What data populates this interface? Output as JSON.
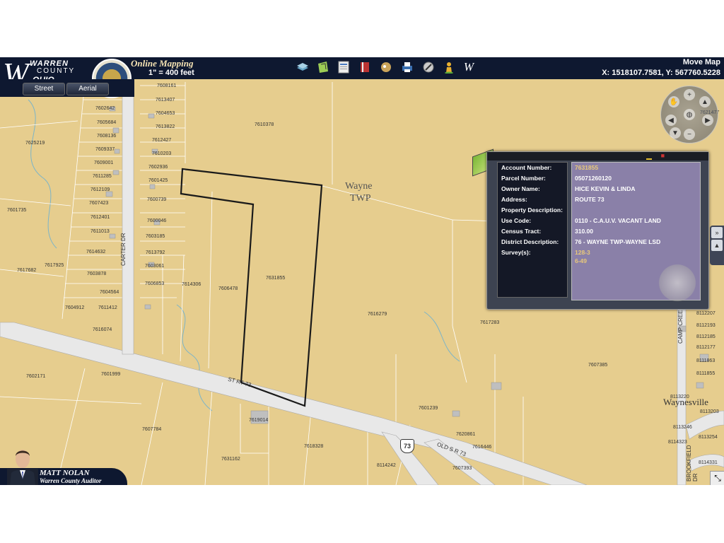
{
  "header": {
    "logo_w": "W",
    "logo_warren": "WARREN",
    "logo_county": "COUNTY",
    "logo_ohio": "OHIO",
    "title": "Online Mapping",
    "scale": "1\" = 400 feet",
    "mode_label": "Move Map",
    "coords": "X: 1518107.7581, Y: 567760.5228",
    "toolbar_icons": [
      "layers-icon",
      "map-tools-icon",
      "print-icon",
      "bookmark-icon",
      "identify-icon",
      "printer-icon",
      "settings-icon",
      "person-icon",
      "logo-w-icon"
    ]
  },
  "basemap": {
    "street": "Street",
    "aerial": "Aerial"
  },
  "map": {
    "township_name": "Wayne",
    "township_abbr": "TWP",
    "roads": [
      "CARTER DR",
      "ST RT 73",
      "OLD S R 73",
      "CAMP CREEK",
      "BROOKFIELD DR"
    ],
    "route_shield": "73",
    "town_label": "Waynesville",
    "parcels": [
      "7608161",
      "7602642",
      "7613407",
      "7604653",
      "7605684",
      "7613822",
      "7608136",
      "7612427",
      "7609337",
      "7610203",
      "7609001",
      "7602936",
      "7611285",
      "7601425",
      "7612109",
      "7600739",
      "7607423",
      "7612401",
      "7600046",
      "7611013",
      "7603185",
      "7614632",
      "7613792",
      "7603878",
      "7603061",
      "7604564",
      "7606853",
      "7611412",
      "7604912",
      "7616074",
      "7625219",
      "7601735",
      "7617682",
      "7617925",
      "7614306",
      "7606478",
      "7631855",
      "7610378",
      "7616279",
      "7617283",
      "7607385",
      "7602171",
      "7601999",
      "7607784",
      "7619014",
      "7601239",
      "7618328",
      "7620861",
      "7616446",
      "7607393",
      "7631162",
      "8114242",
      "7621477",
      "8112207",
      "8112193",
      "8112185",
      "8112177",
      "8111863",
      "8111855",
      "8113220",
      "8113203",
      "8113246",
      "8114323",
      "8113254",
      "8114331"
    ]
  },
  "popup": {
    "fields": [
      {
        "label": "Account Number:",
        "value": "7631855"
      },
      {
        "label": "Parcel Number:",
        "value": "05071260120"
      },
      {
        "label": "Owner Name:",
        "value": "HICE KEVIN & LINDA"
      },
      {
        "label": "Address:",
        "value": "ROUTE 73"
      },
      {
        "label": "Property Description:",
        "value": ""
      },
      {
        "label": "Use Code:",
        "value": "0110 - C.A.U.V. VACANT LAND"
      },
      {
        "label": "Census Tract:",
        "value": "310.00"
      },
      {
        "label": "District Description:",
        "value": "76 - WAYNE TWP-WAYNE LSD"
      },
      {
        "label": "Survey(s):",
        "value": "128-3"
      }
    ],
    "survey_extra": "6-49"
  },
  "auditor": {
    "name": "MATT NOLAN",
    "title": "Warren County Auditor"
  },
  "colors": {
    "header_bg": "#0e1830",
    "map_bg": "#e6cd8e",
    "parcel_line": "#ffffff",
    "highlight": "#111111",
    "popup_bg": "#8a80a8"
  }
}
